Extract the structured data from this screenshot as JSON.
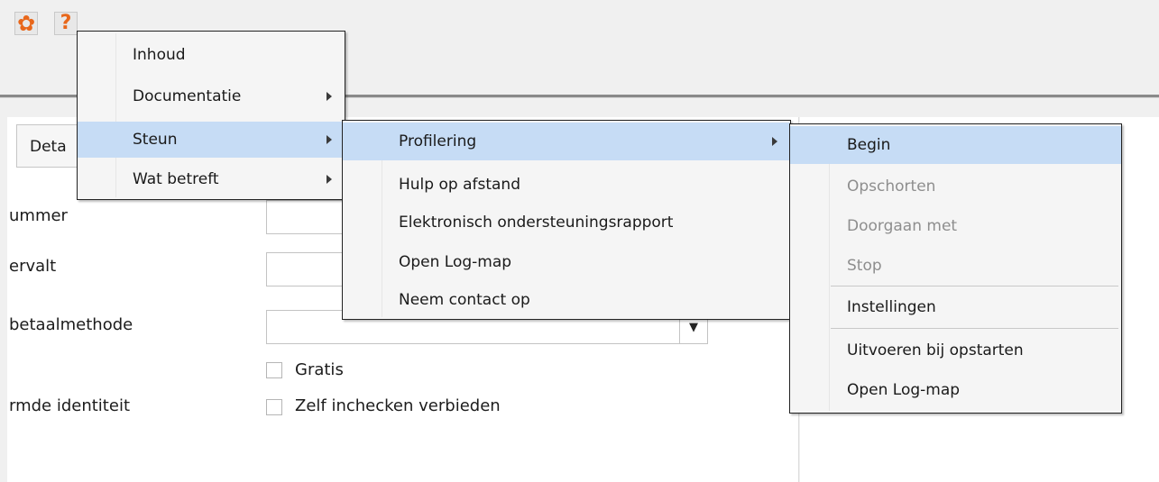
{
  "toolbar": {
    "settings_icon": "gear-icon",
    "help_icon": "question-icon",
    "help_glyph": "?"
  },
  "tab": {
    "label": "Deta"
  },
  "form": {
    "labels": {
      "nummer": "ummer",
      "vervalt": "ervalt",
      "betaalmethode": "betaalmethode",
      "identiteit": "rmde identiteit"
    },
    "checkboxes": {
      "gratis": "Gratis",
      "zelf_inchecken": "Zelf inchecken verbieden"
    }
  },
  "help_menu": {
    "items": [
      {
        "label": "Inhoud",
        "has_submenu": false
      },
      {
        "label": "Documentatie",
        "has_submenu": true
      },
      {
        "label": "Steun",
        "has_submenu": true,
        "active": true
      },
      {
        "label": "Wat betreft",
        "has_submenu": true
      }
    ]
  },
  "steun_menu": {
    "items": [
      {
        "label": "Profilering",
        "has_submenu": true,
        "active": true
      },
      {
        "label": "Hulp op afstand"
      },
      {
        "label": "Elektronisch ondersteuningsrapport"
      },
      {
        "label": "Open Log-map"
      },
      {
        "label": "Neem contact op"
      }
    ]
  },
  "profilering_menu": {
    "items": [
      {
        "label": "Begin",
        "active": true
      },
      {
        "label": "Opschorten",
        "disabled": true
      },
      {
        "label": "Doorgaan met",
        "disabled": true
      },
      {
        "label": "Stop",
        "disabled": true
      },
      {
        "label": "Instellingen"
      },
      {
        "label": "Uitvoeren bij opstarten"
      },
      {
        "label": "Open Log-map"
      }
    ]
  },
  "colors": {
    "accent_orange": "#e8671b",
    "menu_highlight": "#c6dcf5",
    "disabled_text": "#8e8e8e"
  }
}
